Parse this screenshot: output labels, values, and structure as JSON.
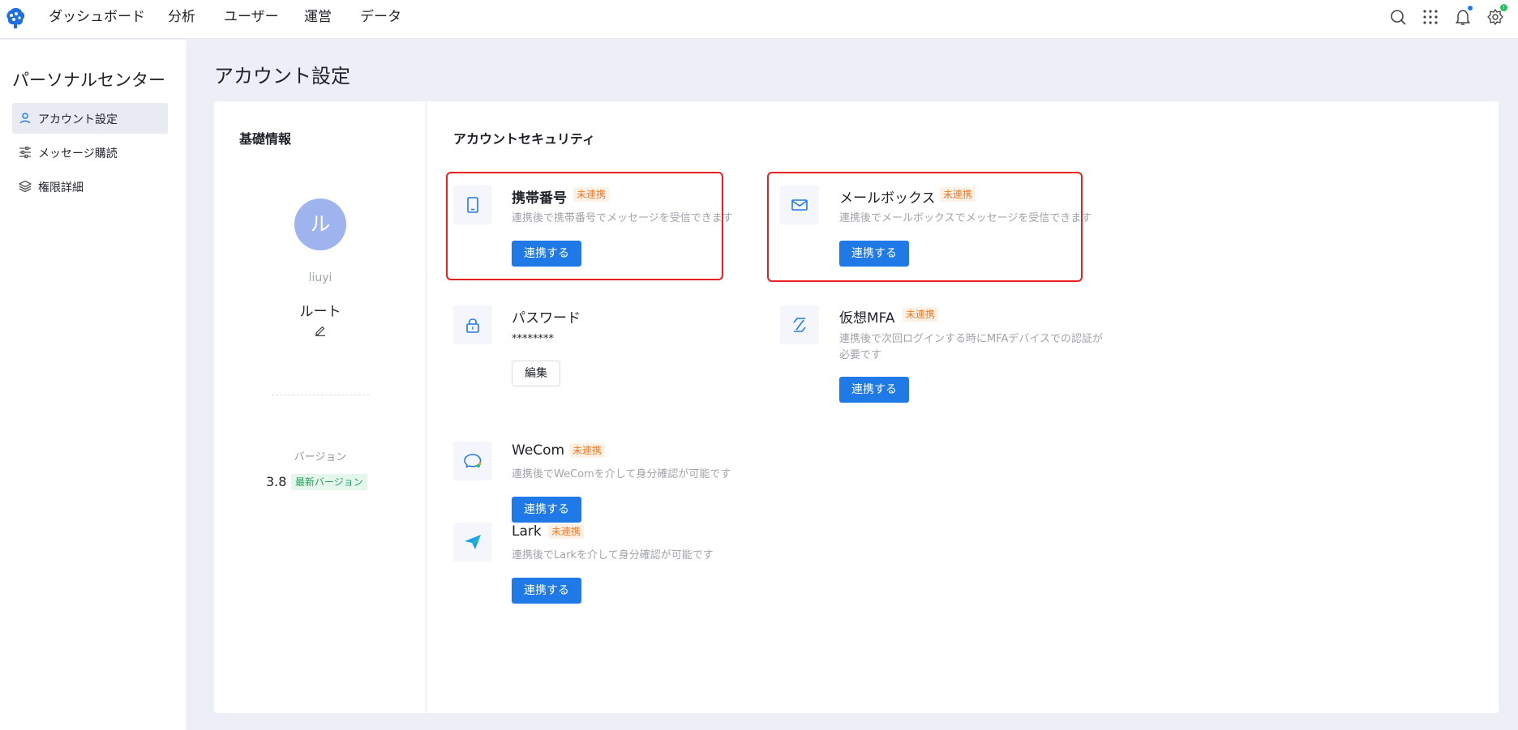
{
  "nav": {
    "items": [
      "ダッシュボード",
      "分析",
      "ユーザー",
      "運営",
      "データ"
    ],
    "notification_badge_color": "#1f7ae8",
    "settings_badge_color": "#22c55e",
    "settings_badge_text": "!"
  },
  "sidebar": {
    "title": "パーソナルセンター",
    "items": [
      {
        "label": "アカウント設定",
        "icon": "user-icon",
        "active": true
      },
      {
        "label": "メッセージ購読",
        "icon": "sliders-icon",
        "active": false
      },
      {
        "label": "権限詳細",
        "icon": "layers-icon",
        "active": false
      }
    ]
  },
  "page": {
    "title": "アカウント設定"
  },
  "basic": {
    "title": "基礎情報",
    "avatar_text": "ル",
    "username": "liuyi",
    "role": "ルート",
    "version_label": "バージョン",
    "version": "3.8",
    "version_badge": "最新バージョン"
  },
  "security": {
    "title": "アカウントセキュリティ",
    "phone": {
      "title": "携帯番号",
      "tag": "未連携",
      "desc": "連携後で携帯番号でメッセージを受信できます",
      "button": "連携する"
    },
    "email": {
      "title": "メールボックス",
      "tag": "未連携",
      "desc": "連携後でメールボックスでメッセージを受信できます",
      "button": "連携する"
    },
    "password": {
      "title": "パスワード",
      "value": "********",
      "button": "編集"
    },
    "mfa": {
      "title": "仮想MFA",
      "tag": "未連携",
      "desc_line1": "連携後で次回ログインする時にMFAデバイスでの認証が",
      "desc_line2": "必要です",
      "button": "連携する"
    },
    "wecom": {
      "title": "WeCom",
      "tag": "未連携",
      "desc": "連携後でWeComを介して身分確認が可能です",
      "button": "連携する"
    },
    "lark": {
      "title": "Lark",
      "tag": "未連携",
      "desc": "連携後でLarkを介して身分確認が可能です",
      "button": "連携する"
    }
  },
  "colors": {
    "primary": "#1f7ae8",
    "highlight_border": "#e8201f",
    "tag_orange": "#f07a25"
  }
}
